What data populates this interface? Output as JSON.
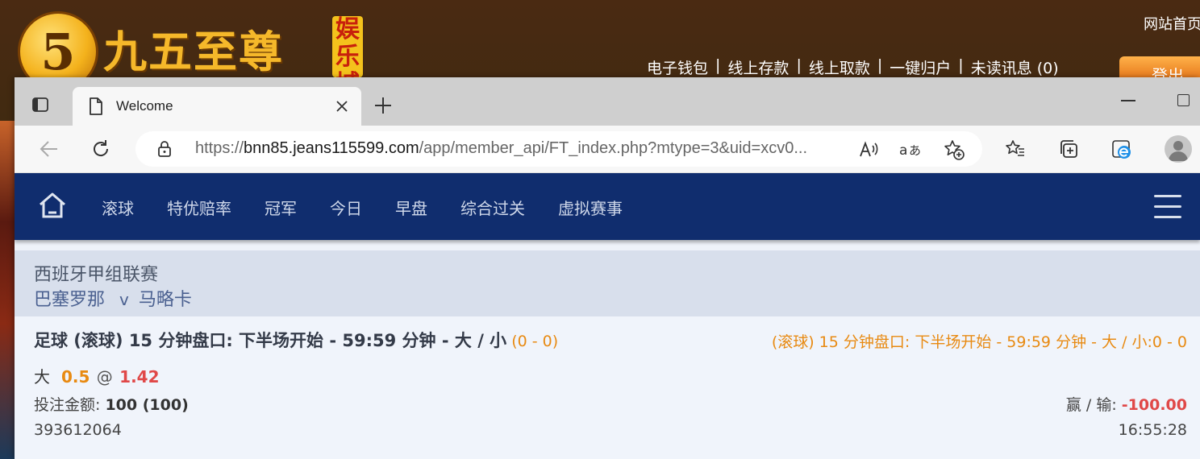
{
  "background_site": {
    "logo_numeral": "5",
    "logo_text": "九五至尊",
    "logo_badge": "娱乐城",
    "home_link": "网站首页",
    "links": [
      "电子钱包",
      "线上存款",
      "线上取款",
      "一键归户",
      "未读讯息 (0)"
    ],
    "login_button": "登出"
  },
  "browser": {
    "tab_title": "Welcome",
    "url_scheme": "https://",
    "url_host": "bnn85.jeans115599.com",
    "url_path": "/app/member_api/FT_index.php?mtype=3&uid=xcv0...",
    "icons": [
      "tab-actions-icon",
      "page-icon",
      "close-icon",
      "plus-icon",
      "back-icon",
      "refresh-icon",
      "lock-icon",
      "read-aloud-icon",
      "translate-icon",
      "add-favorite-icon",
      "favorites-icon",
      "collections-icon",
      "edge-icon",
      "profile-icon"
    ]
  },
  "nav": {
    "items": [
      "滚球",
      "特优赔率",
      "冠军",
      "今日",
      "早盘",
      "综合过关",
      "虚拟赛事"
    ]
  },
  "league": {
    "name": "西班牙甲组联赛",
    "home_team": "巴塞罗那",
    "versus": "v",
    "away_team": "马略卡"
  },
  "bet": {
    "title": "足球 (滚球) 15 分钟盘口: 下半场开始 - 59:59 分钟 - 大 / 小",
    "score": "(0 - 0)",
    "live_info": "(滚球) 15 分钟盘口: 下半场开始 - 59:59 分钟 - 大 / 小:0 - 0",
    "pick": "大",
    "line": "0.5",
    "at": "@",
    "odds": "1.42",
    "amount_label": "投注金额:",
    "amount_value": "100 (100)",
    "winloss_label": "赢 / 输:",
    "winloss_value": "-100.00",
    "ticket_id": "393612064",
    "time": "16:55:28"
  },
  "colors": {
    "nav_bg": "#102d6e",
    "accent_orange": "#e88a12",
    "loss_red": "#e04848"
  }
}
